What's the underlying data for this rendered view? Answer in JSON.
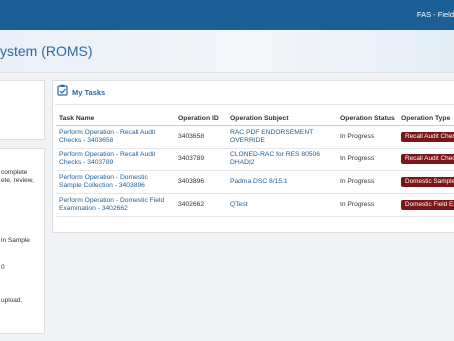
{
  "topbar": {
    "text": "FAS - Field"
  },
  "header": {
    "title": "ystem (ROMS)"
  },
  "left_panel": {
    "lines": [
      "complete",
      "ete, review,",
      "in Sample",
      "0",
      "upload."
    ]
  },
  "tasks": {
    "title": "My Tasks",
    "columns": {
      "task_name": "Task Name",
      "operation_id": "Operation ID",
      "operation_subject": "Operation Subject",
      "operation_status": "Operation Status",
      "operation_type": "Operation Type"
    },
    "rows": [
      {
        "task_name": "Perform Operation - Recall Audit Checks - 3403658",
        "operation_id": "3403658",
        "operation_subject": "RAC PDF ENDORSEMENT OVERRIDE",
        "operation_status": "In Progress",
        "operation_type": "Recall Audit Chec"
      },
      {
        "task_name": "Perform Operation - Recall Audit Checks - 3403789",
        "operation_id": "3403789",
        "operation_subject": "CLONED-RAC for RES 80506 DHADI2",
        "operation_status": "In Progress",
        "operation_type": "Recall Audit Chec"
      },
      {
        "task_name": "Perform Operation - Domestic Sample Collection - 3403896",
        "operation_id": "3403896",
        "operation_subject": "Padma DSC 8/15.1",
        "operation_status": "In Progress",
        "operation_type": "Domestic Sample Co"
      },
      {
        "task_name": "Perform Operation - Domestic Field Examination - 3402662",
        "operation_id": "3402662",
        "operation_subject": "QTest",
        "operation_status": "In Progress",
        "operation_type": "Domestic Field Exam"
      }
    ]
  },
  "colors": {
    "topbar": "#1c5f97",
    "link": "#1f5f97",
    "badge": "#7a1616",
    "title": "#2a6aa3"
  }
}
